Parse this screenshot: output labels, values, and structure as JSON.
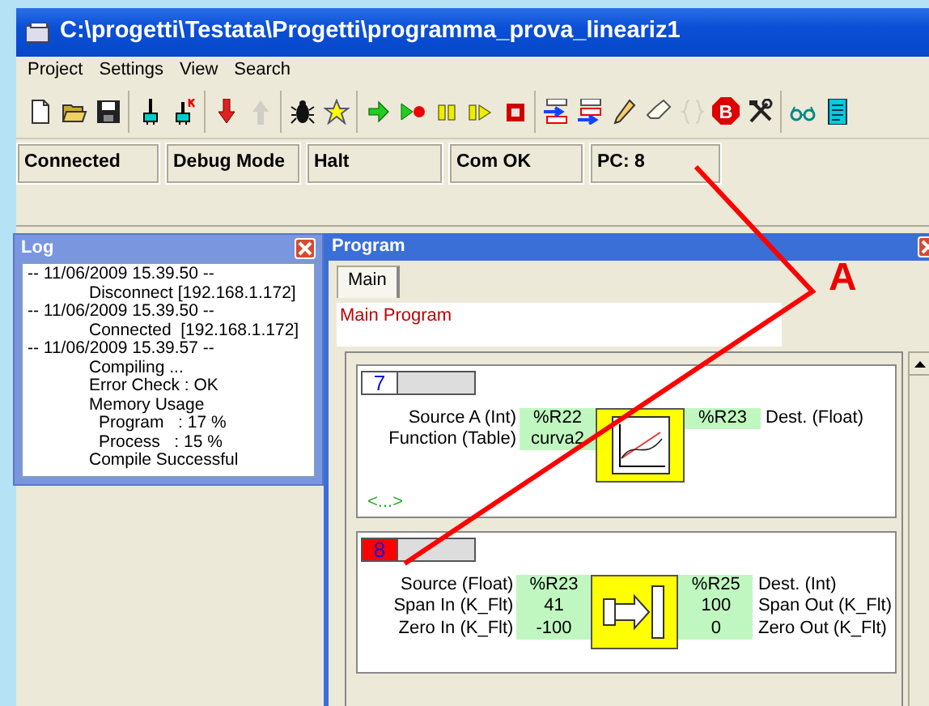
{
  "window": {
    "title": "C:\\progetti\\Testata\\Progetti\\programma_prova_lineariz1"
  },
  "menu": [
    "Project",
    "Settings",
    "View",
    "Search"
  ],
  "toolbar": [
    [
      {
        "kind": "new",
        "disabled": false
      },
      {
        "kind": "open",
        "disabled": false
      },
      {
        "kind": "save",
        "disabled": false
      }
    ],
    [
      {
        "kind": "connect",
        "disabled": false
      },
      {
        "kind": "disconnect",
        "disabled": false
      }
    ],
    [
      {
        "kind": "download",
        "disabled": false
      },
      {
        "kind": "upload",
        "disabled": true
      }
    ],
    [
      {
        "kind": "bug",
        "disabled": false
      },
      {
        "kind": "star",
        "disabled": false
      }
    ],
    [
      {
        "kind": "run",
        "disabled": false
      },
      {
        "kind": "run-to",
        "disabled": false
      },
      {
        "kind": "pause",
        "disabled": false
      },
      {
        "kind": "step",
        "disabled": false
      },
      {
        "kind": "stop",
        "disabled": false
      }
    ],
    [
      {
        "kind": "insert-above",
        "disabled": false
      },
      {
        "kind": "insert-below",
        "disabled": false
      },
      {
        "kind": "pencil",
        "disabled": false
      },
      {
        "kind": "eraser",
        "disabled": false
      },
      {
        "kind": "braces",
        "disabled": true
      },
      {
        "kind": "breakpoint",
        "disabled": false,
        "text": "B"
      },
      {
        "kind": "tools",
        "disabled": false
      }
    ],
    [
      {
        "kind": "glasses",
        "disabled": false
      },
      {
        "kind": "document",
        "disabled": false
      }
    ]
  ],
  "status_bar": [
    "Connected",
    "Debug Mode",
    "Halt",
    "Com OK",
    "PC: 8"
  ],
  "log": {
    "title": "Log",
    "entries": [
      {
        "text": "-- 11/06/2009 15.39.50 --",
        "children": [
          {
            "text": "Disconnect [192.168.1.172]"
          }
        ]
      },
      {
        "text": "-- 11/06/2009 15.39.50 --",
        "children": [
          {
            "text": "Connected  [192.168.1.172]"
          }
        ]
      },
      {
        "text": "-- 11/06/2009 15.39.57 --",
        "children": [
          {
            "text": "Compiling ..."
          },
          {
            "text": "Error Check : OK"
          },
          {
            "text": "Memory Usage",
            "children": [
              {
                "text": "Program   : 17 %"
              },
              {
                "text": "Process   : 15 %"
              }
            ]
          },
          {
            "text": "Compile Successful"
          }
        ]
      }
    ]
  },
  "program": {
    "title": "Program",
    "tabs": [
      {
        "label": "Main",
        "selected": true
      }
    ],
    "header": "Main Program",
    "blocks": [
      {
        "number": "7",
        "selected": false,
        "kind": "table",
        "inputs": [
          {
            "label": "Source A (Int)",
            "value": "%R22"
          },
          {
            "label": "Function (Table)",
            "value": "curva2"
          }
        ],
        "outputs": [
          {
            "value": "%R23",
            "label": "Dest. (Float)"
          }
        ],
        "footer": "<...>"
      },
      {
        "number": "8",
        "selected": true,
        "kind": "scale",
        "inputs": [
          {
            "label": "Source (Float)",
            "value": "%R23"
          },
          {
            "label": "Span In (K_Flt)",
            "value": "41"
          },
          {
            "label": "Zero In (K_Flt)",
            "value": "-100"
          }
        ],
        "outputs": [
          {
            "value": "%R25",
            "label": "Dest. (Int)"
          },
          {
            "value": "100",
            "label": "Span Out (K_Flt)"
          },
          {
            "value": "0",
            "label": "Zero Out (K_Flt)"
          }
        ]
      }
    ]
  },
  "annotation": {
    "label": "A"
  }
}
